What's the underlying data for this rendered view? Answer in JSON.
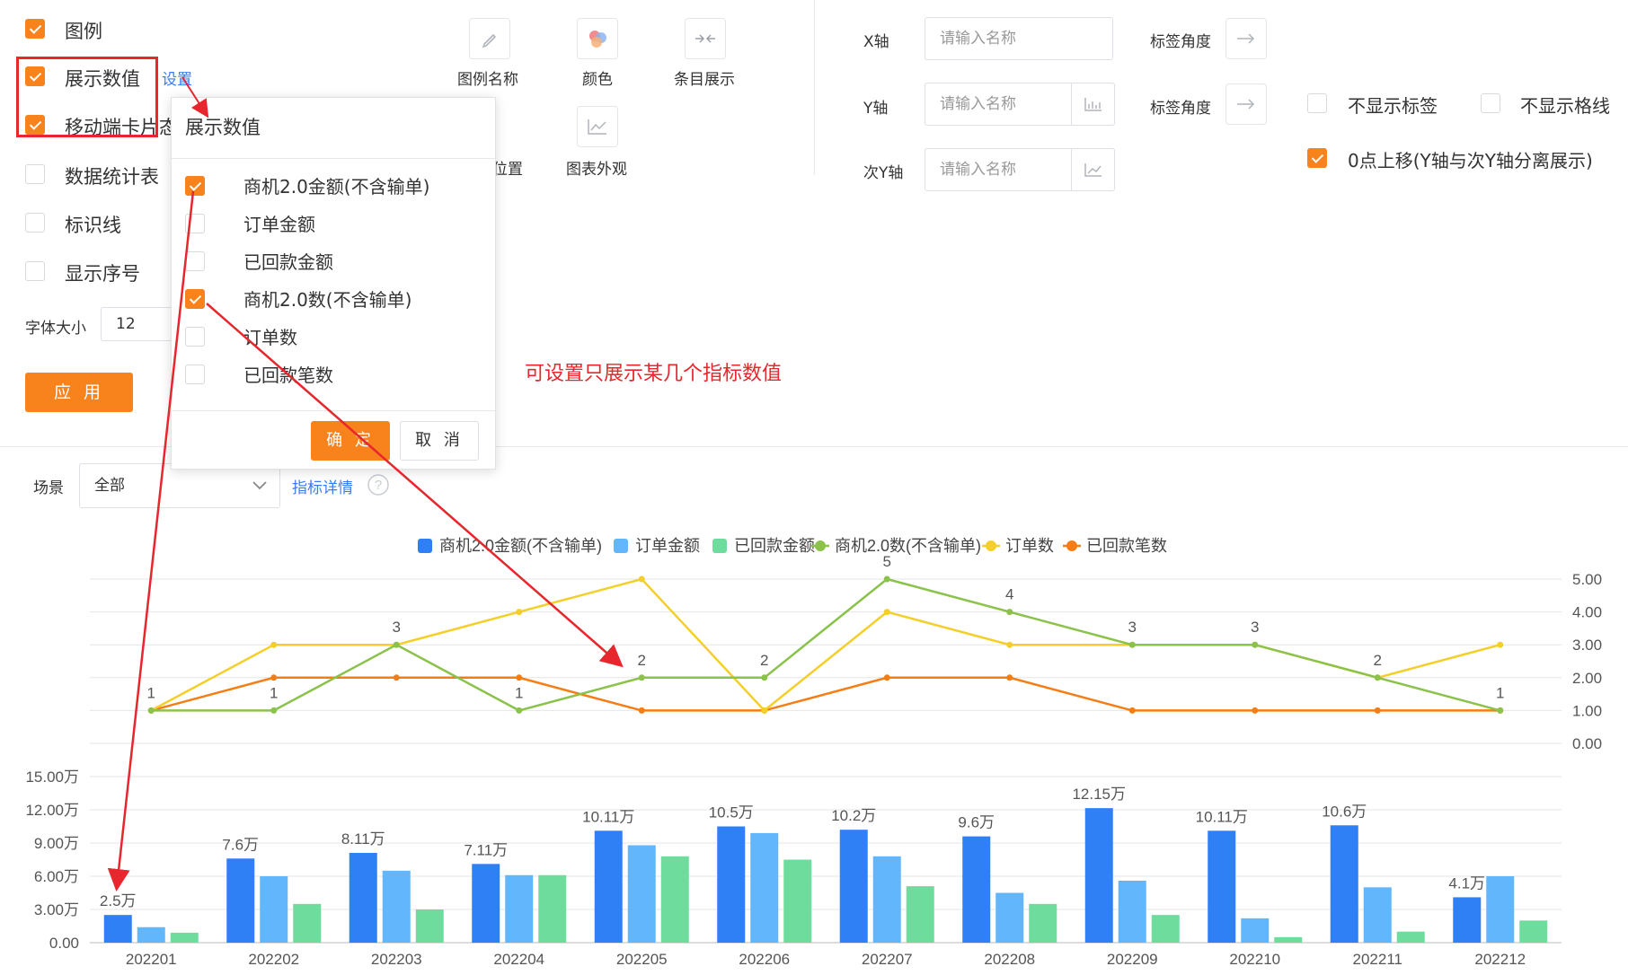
{
  "settings": {
    "legend_label": "图例",
    "show_values_label": "展示数值",
    "show_values_link": "设置",
    "mobile_card_label": "移动端卡片态",
    "data_table_label": "数据统计表",
    "marker_line_label": "标识线",
    "show_index_label": "显示序号",
    "font_size_label": "字体大小",
    "font_size_value": "12",
    "apply_button": "应 用"
  },
  "style_tools": {
    "legend_name": "图例名称",
    "color": "颜色",
    "item_display": "条目展示",
    "legend_position_partial": "位置",
    "chart_appearance": "图表外观"
  },
  "axes": {
    "x_label": "X轴",
    "y_label": "Y轴",
    "y2_label": "次Y轴",
    "name_placeholder": "请输入名称",
    "tick_angle_label": "标签角度",
    "hide_labels": "不显示标签",
    "hide_gridlines": "不显示格线",
    "zero_shift": "0点上移(Y轴与次Y轴分离展示)"
  },
  "popup": {
    "title": "展示数值",
    "items": [
      {
        "label": "商机2.0金额(不含输单)",
        "checked": true
      },
      {
        "label": "订单金额",
        "checked": false
      },
      {
        "label": "已回款金额",
        "checked": false
      },
      {
        "label": "商机2.0数(不含输单)",
        "checked": true
      },
      {
        "label": "订单数",
        "checked": false
      },
      {
        "label": "已回款笔数",
        "checked": false
      }
    ],
    "confirm": "确 定",
    "cancel": "取 消"
  },
  "annotation": "可设置只展示某几个指标数值",
  "filter": {
    "scene_label": "场景",
    "scene_value": "全部",
    "metric_detail_link": "指标详情"
  },
  "colors": {
    "accent": "#f8821b",
    "highlight_red": "#e8262d",
    "link": "#3a7bf0",
    "series": [
      "#2f7ff5",
      "#62b6fb",
      "#6ddc9d",
      "#8ac24a",
      "#f5cf29",
      "#f47d15"
    ]
  },
  "chart_data": {
    "type": "bar",
    "categories": [
      "202201",
      "202202",
      "202203",
      "202204",
      "202205",
      "202206",
      "202207",
      "202208",
      "202209",
      "202210",
      "202211",
      "202212"
    ],
    "legend": [
      "商机2.0金额(不含输单)",
      "订单金额",
      "已回款金额",
      "商机2.0数(不含输单)",
      "订单数",
      "已回款笔数"
    ],
    "bar_series": [
      {
        "name": "商机2.0金额(不含输单)",
        "values": [
          2.5,
          7.6,
          8.11,
          7.11,
          10.11,
          10.5,
          10.2,
          9.6,
          12.15,
          10.11,
          10.6,
          4.1
        ],
        "labels": [
          "2.5万",
          "7.6万",
          "8.11万",
          "7.11万",
          "10.11万",
          "10.5万",
          "10.2万",
          "9.6万",
          "12.15万",
          "10.11万",
          "10.6万",
          "4.1万"
        ]
      },
      {
        "name": "订单金额",
        "values": [
          1.4,
          6.0,
          6.5,
          6.1,
          8.8,
          9.9,
          7.8,
          4.5,
          5.6,
          2.2,
          5.0,
          6.0
        ]
      },
      {
        "name": "已回款金额",
        "values": [
          0.9,
          3.5,
          3.0,
          6.1,
          7.8,
          7.5,
          5.1,
          3.5,
          2.5,
          0.5,
          1.0,
          2.0
        ]
      }
    ],
    "line_series": [
      {
        "name": "商机2.0数(不含输单)",
        "values": [
          1,
          1,
          3,
          1,
          2,
          2,
          5,
          4,
          3,
          3,
          2,
          1
        ],
        "labels": [
          "1",
          "1",
          "3",
          "1",
          "2",
          "2",
          "5",
          "4",
          "3",
          "3",
          "2",
          "1"
        ]
      },
      {
        "name": "订单数",
        "values": [
          1,
          3,
          3,
          4,
          5,
          1,
          4,
          3,
          3,
          3,
          2,
          3
        ]
      },
      {
        "name": "已回款笔数",
        "values": [
          1,
          2,
          2,
          2,
          1,
          1,
          2,
          2,
          1,
          1,
          1,
          1
        ]
      }
    ],
    "y_left_ticks": [
      "0.00",
      "3.00万",
      "6.00万",
      "9.00万",
      "12.00万",
      "15.00万"
    ],
    "y_left_range": [
      0,
      15
    ],
    "y_right_ticks": [
      "0.00",
      "1.00",
      "2.00",
      "3.00",
      "4.00",
      "5.00"
    ],
    "y_right_range": [
      0,
      5
    ],
    "legend_position": "top-center",
    "grid": true
  }
}
